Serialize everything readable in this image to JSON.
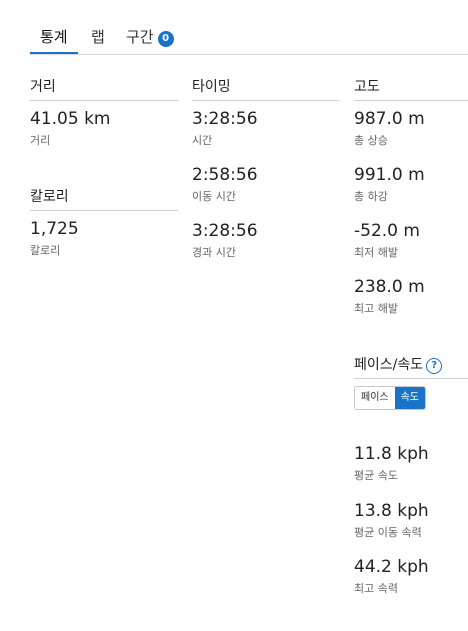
{
  "tabs": [
    {
      "label": "통계"
    },
    {
      "label": "랩"
    },
    {
      "label": "구간",
      "badge": "0"
    }
  ],
  "distance": {
    "heading": "거리",
    "value": "41.05 km",
    "label": "거리"
  },
  "calories": {
    "heading": "칼로리",
    "value": "1,725",
    "label": "칼로리"
  },
  "timing": {
    "heading": "타이밍",
    "stats": [
      {
        "value": "3:28:56",
        "label": "시간"
      },
      {
        "value": "2:58:56",
        "label": "이동 시간"
      },
      {
        "value": "3:28:56",
        "label": "경과 시간"
      }
    ]
  },
  "elevation": {
    "heading": "고도",
    "stats": [
      {
        "value": "987.0 m",
        "label": "총 상승"
      },
      {
        "value": "991.0 m",
        "label": "총 하강"
      },
      {
        "value": "-52.0 m",
        "label": "최저 해발"
      },
      {
        "value": "238.0 m",
        "label": "최고 해발"
      }
    ]
  },
  "pace_speed": {
    "heading": "페이스/속도",
    "help_icon": "question-circle-icon",
    "toggle": {
      "pace_label": "페이스",
      "speed_label": "속도",
      "selected": "speed"
    },
    "stats": [
      {
        "value": "11.8 kph",
        "label": "평균 속도"
      },
      {
        "value": "13.8 kph",
        "label": "평균 이동 속력"
      },
      {
        "value": "44.2 kph",
        "label": "최고 속력"
      }
    ]
  },
  "colors": {
    "accent": "#1a73c8"
  }
}
